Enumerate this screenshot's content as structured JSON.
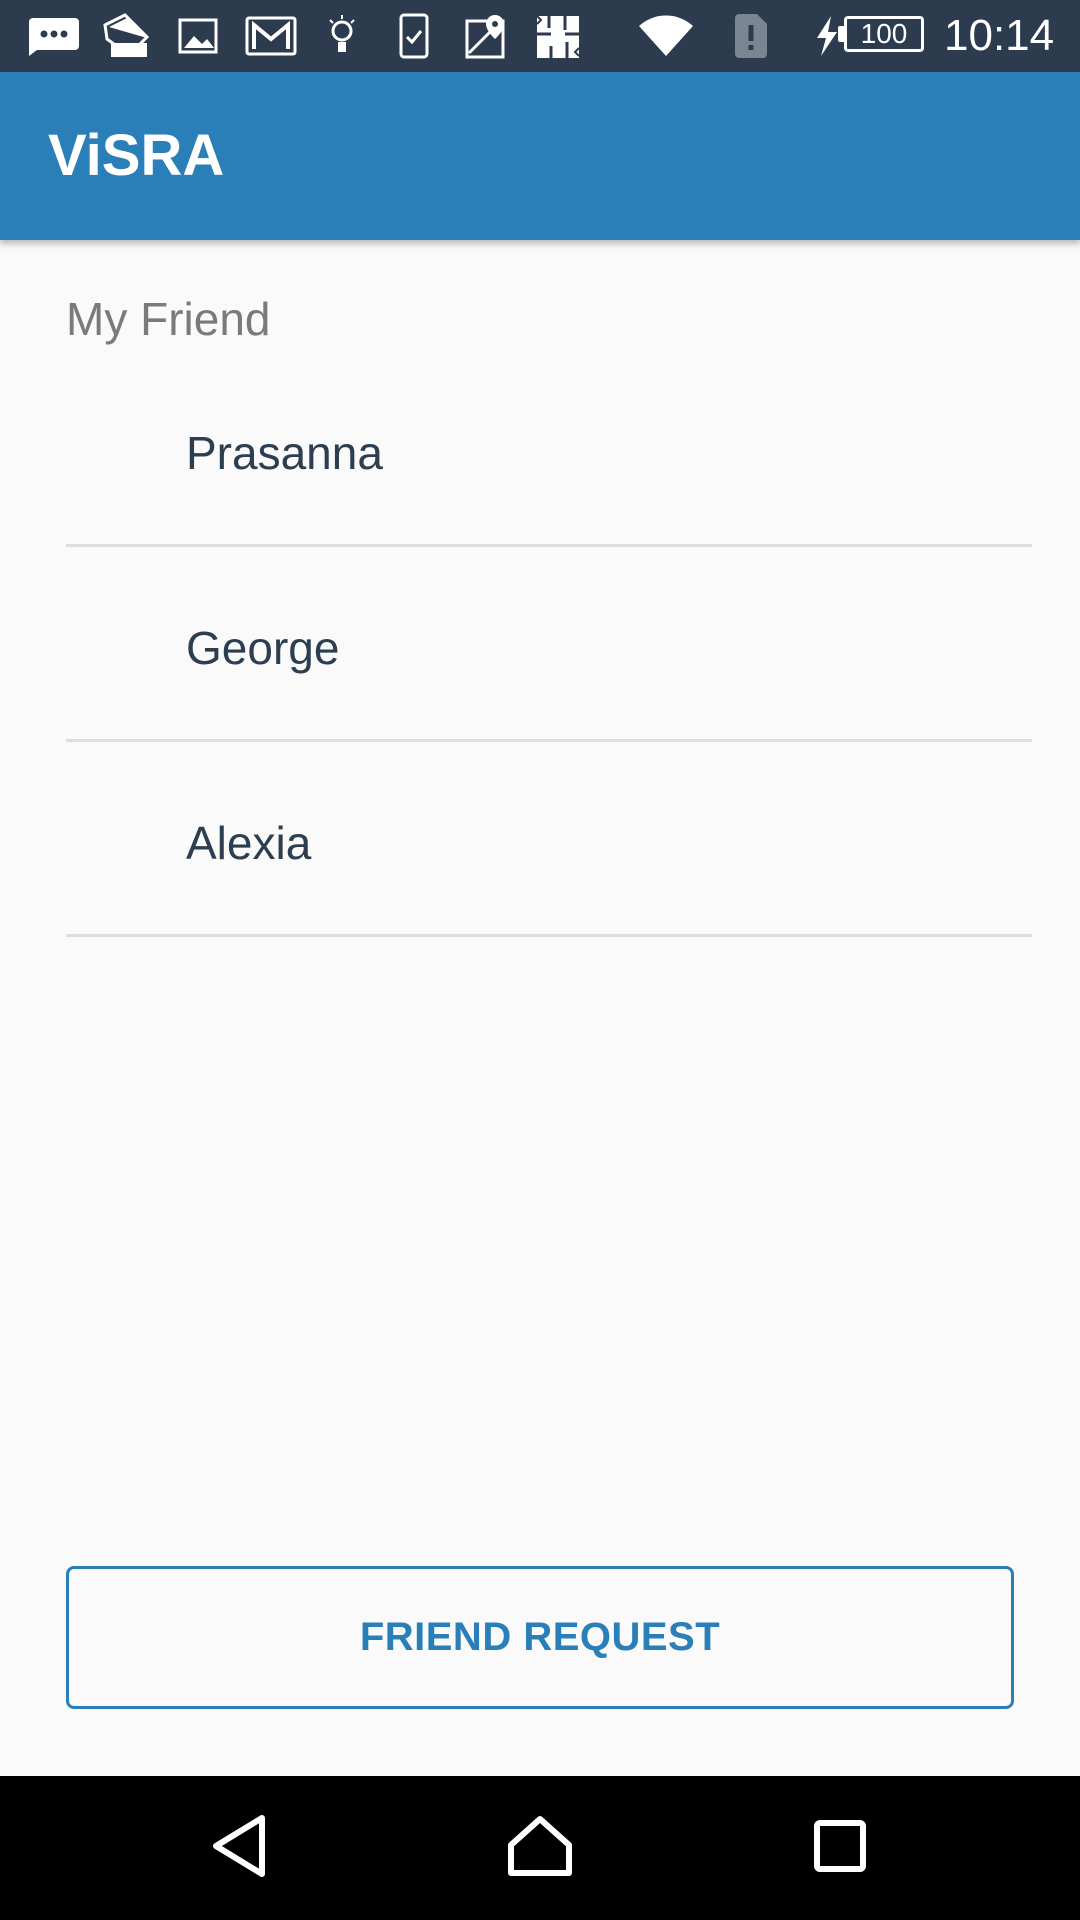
{
  "status_bar": {
    "icons": [
      "sms-icon",
      "tags-icon",
      "image-icon",
      "gmail-icon",
      "lightbulb-icon",
      "task-icon",
      "maps-icon",
      "puzzle-icon",
      "wifi-icon",
      "sim-alert-icon",
      "charging-icon"
    ],
    "battery_level": "100",
    "time": "10:14"
  },
  "app_bar": {
    "title": "ViSRA",
    "color": "#2a7fb8"
  },
  "friends": {
    "header": "My Friend",
    "items": [
      {
        "name": "Prasanna"
      },
      {
        "name": "George"
      },
      {
        "name": "Alexia"
      }
    ]
  },
  "actions": {
    "friend_request_label": "FRIEND REQUEST"
  },
  "navigation": {
    "buttons": [
      "back-icon",
      "home-icon",
      "recents-icon"
    ]
  }
}
